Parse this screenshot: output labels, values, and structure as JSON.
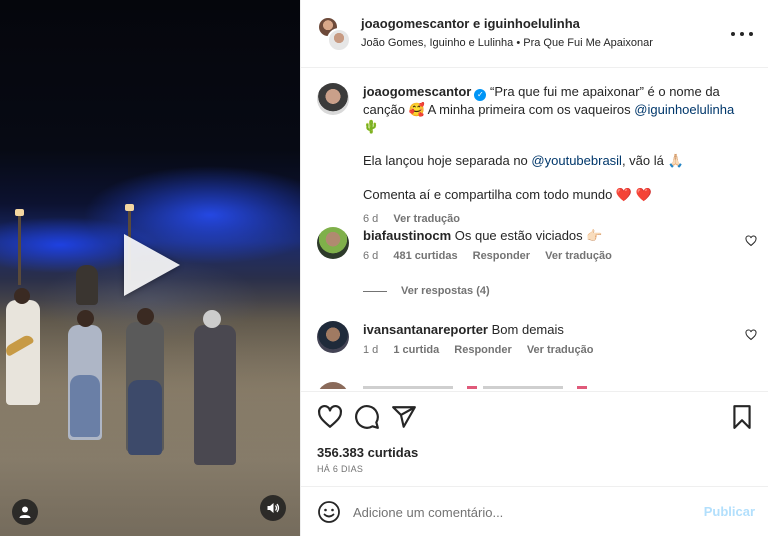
{
  "header": {
    "author1": "joaogomescantor",
    "conjunction": "e",
    "author2": "iguinhoelulinha",
    "subtitle": "João Gomes, Iguinho e Lulinha • Pra Que Fui Me Apaixonar"
  },
  "caption": {
    "username": "joaogomescantor",
    "line1": "“Pra que fui me apaixonar” é o nome da canção 🥰 A minha primeira com os vaqueiros",
    "mention1": "@iguinhoelulinha",
    "line1_end": "🌵",
    "line2": "Ela lançou hoje separada no",
    "mention2": "@youtubebrasil",
    "line2_end": ", vão lá 🙏🏻",
    "line3": "Comenta aí e compartilha com todo mundo ❤️ ❤️",
    "time": "6 d",
    "translate": "Ver tradução"
  },
  "comments": [
    {
      "username": "biafaustinocm",
      "text": "Os que estão viciados 👉🏻",
      "time": "6 d",
      "likes": "481 curtidas",
      "reply": "Responder",
      "translate": "Ver tradução"
    },
    {
      "username": "ivansantanareporter",
      "text": "Bom demais",
      "time": "1 d",
      "likes": "1 curtida",
      "reply": "Responder",
      "translate": "Ver tradução"
    }
  ],
  "view_replies": "Ver respostas (4)",
  "likes_count": "356.383 curtidas",
  "post_date": "HÁ 6 DIAS",
  "add_comment": {
    "placeholder": "Adicione um comentário...",
    "post_label": "Publicar"
  },
  "colors": {
    "link": "#00376b",
    "verified": "#0095f6",
    "muted": "#737373",
    "post_disabled": "#b2dffc"
  },
  "icons": [
    "play-icon",
    "user-tag-icon",
    "volume-icon",
    "more-icon",
    "verified-icon",
    "heart-icon",
    "comment-icon",
    "share-icon",
    "bookmark-icon",
    "emoji-icon"
  ]
}
